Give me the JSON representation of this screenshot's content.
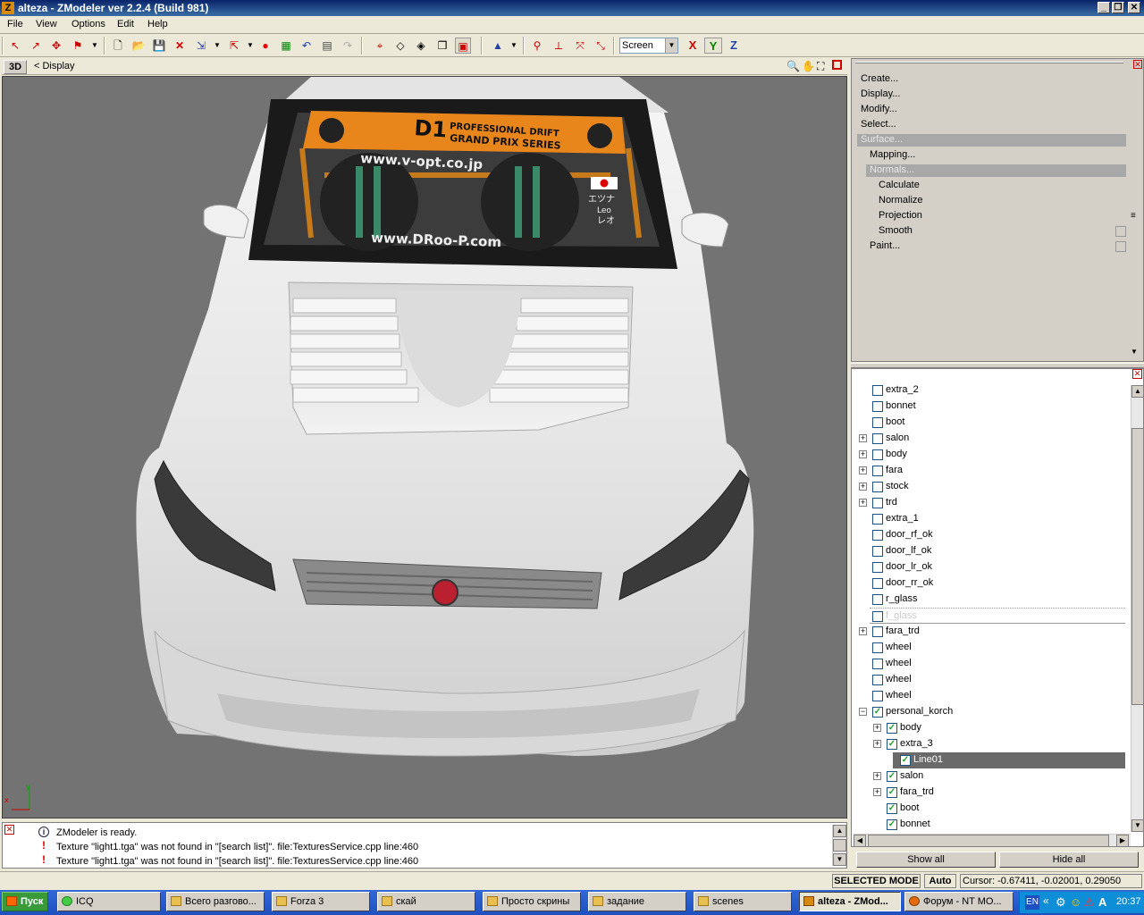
{
  "window": {
    "title": "alteza - ZModeler ver 2.2.4 (Build 981)",
    "app_icon": "Z"
  },
  "menubar": [
    "File",
    "View",
    "Options",
    "Edit",
    "Help"
  ],
  "toolbar": {
    "screen_select": "Screen",
    "axis_x": "X",
    "axis_y": "Y",
    "axis_z": "Z"
  },
  "viewport": {
    "mode_button": "3D",
    "display_label": "< Display",
    "banner_top": "D1",
    "banner_line1": "PROFESSIONAL DRIFT",
    "banner_line2": "GRAND PRIX SERIES",
    "windshield_url1": "www.v-opt.co.jp",
    "windshield_url2": "www.DRoo-P.com",
    "driver_name1": "エツナ",
    "driver_name2": "Leo",
    "driver_name3": "レオ",
    "axis_x": "x",
    "axis_y": "y"
  },
  "command_panel": {
    "items": [
      "Create...",
      "Display...",
      "Modify...",
      "Select...",
      "Surface...",
      "Mapping...",
      "Normals...",
      "Calculate",
      "Normalize",
      "Projection",
      "Smooth",
      "Paint..."
    ]
  },
  "tree": {
    "items": [
      {
        "label": "extra_2",
        "checked": false,
        "expand": false
      },
      {
        "label": "bonnet",
        "checked": false,
        "expand": false
      },
      {
        "label": "boot",
        "checked": false,
        "expand": false
      },
      {
        "label": "salon",
        "checked": false,
        "expand": true
      },
      {
        "label": "body",
        "checked": false,
        "expand": true
      },
      {
        "label": "fara",
        "checked": false,
        "expand": true
      },
      {
        "label": "stock",
        "checked": false,
        "expand": true
      },
      {
        "label": "trd",
        "checked": false,
        "expand": true
      },
      {
        "label": "extra_1",
        "checked": false,
        "expand": false
      },
      {
        "label": "door_rf_ok",
        "checked": false,
        "expand": false
      },
      {
        "label": "door_lf_ok",
        "checked": false,
        "expand": false
      },
      {
        "label": "door_lr_ok",
        "checked": false,
        "expand": false
      },
      {
        "label": "door_rr_ok",
        "checked": false,
        "expand": false
      },
      {
        "label": "r_glass",
        "checked": false,
        "expand": false
      },
      {
        "label": "f_glass",
        "checked": false,
        "expand": false
      },
      {
        "label": "fara_trd",
        "checked": false,
        "expand": true
      },
      {
        "label": "wheel",
        "checked": false,
        "expand": false
      },
      {
        "label": "wheel",
        "checked": false,
        "expand": false
      },
      {
        "label": "wheel",
        "checked": false,
        "expand": false
      },
      {
        "label": "wheel",
        "checked": false,
        "expand": false
      },
      {
        "label": "personal_korch",
        "checked": true,
        "expand": true,
        "expanded": true
      },
      {
        "label": "body",
        "checked": true,
        "expand": true
      },
      {
        "label": "extra_3",
        "checked": true,
        "expand": true
      },
      {
        "label": "Line01",
        "checked": true,
        "expand": false
      },
      {
        "label": "salon",
        "checked": true,
        "expand": true
      },
      {
        "label": "fara_trd",
        "checked": true,
        "expand": true
      },
      {
        "label": "boot",
        "checked": true,
        "expand": false
      },
      {
        "label": "bonnet",
        "checked": true,
        "expand": false
      }
    ],
    "show_all": "Show all",
    "hide_all": "Hide all"
  },
  "log": [
    "ZModeler is ready.",
    "Texture \"light1.tga\" was not found in \"[search list]\". file:TexturesService.cpp line:460",
    "Texture \"light1.tga\" was not found in \"[search list]\". file:TexturesService.cpp line:460"
  ],
  "status": {
    "mode": "SELECTED MODE",
    "auto": "Auto",
    "cursor": "Cursor: -0.67411, -0.02001, 0.29050"
  },
  "taskbar": {
    "start": "Пуск",
    "buttons": [
      "ICQ",
      "Всего разгово...",
      "Forza 3",
      "скай",
      "Просто скрины",
      "задание",
      "scenes",
      "alteza - ZMod...",
      "Форум - NT MO..."
    ],
    "lang": "EN",
    "clock": "20:37"
  }
}
